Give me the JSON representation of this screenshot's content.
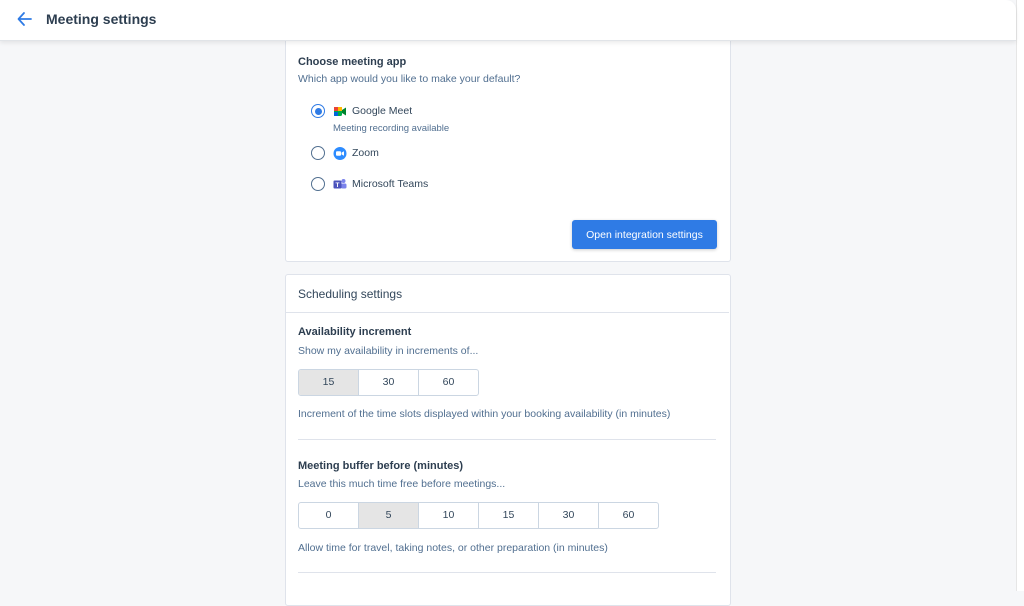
{
  "header": {
    "title": "Meeting settings",
    "back_icon": "arrow-left-icon"
  },
  "meeting_app": {
    "title": "Choose meeting app",
    "subtitle": "Which app would you like to make your default?",
    "options": [
      {
        "label": "Google Meet",
        "note": "Meeting recording available",
        "selected": true,
        "icon": "google-meet-icon"
      },
      {
        "label": "Zoom",
        "selected": false,
        "icon": "zoom-icon"
      },
      {
        "label": "Microsoft Teams",
        "selected": false,
        "icon": "microsoft-teams-icon"
      }
    ],
    "button_label": "Open integration settings"
  },
  "scheduling": {
    "title": "Scheduling settings",
    "availability": {
      "title": "Availability increment",
      "subtitle": "Show my availability in increments of...",
      "options": [
        "15",
        "30",
        "60"
      ],
      "selected": "15",
      "hint": "Increment of the time slots displayed within your booking availability (in minutes)"
    },
    "buffer_before": {
      "title": "Meeting buffer before (minutes)",
      "subtitle": "Leave this much time free before meetings...",
      "options": [
        "0",
        "5",
        "10",
        "15",
        "30",
        "60"
      ],
      "selected": "5",
      "hint": "Allow time for travel, taking notes, or other preparation (in minutes)"
    }
  },
  "colors": {
    "accent": "#2f7be5",
    "text": "#33475b",
    "muted": "#516f90",
    "border": "#dfe3eb"
  }
}
